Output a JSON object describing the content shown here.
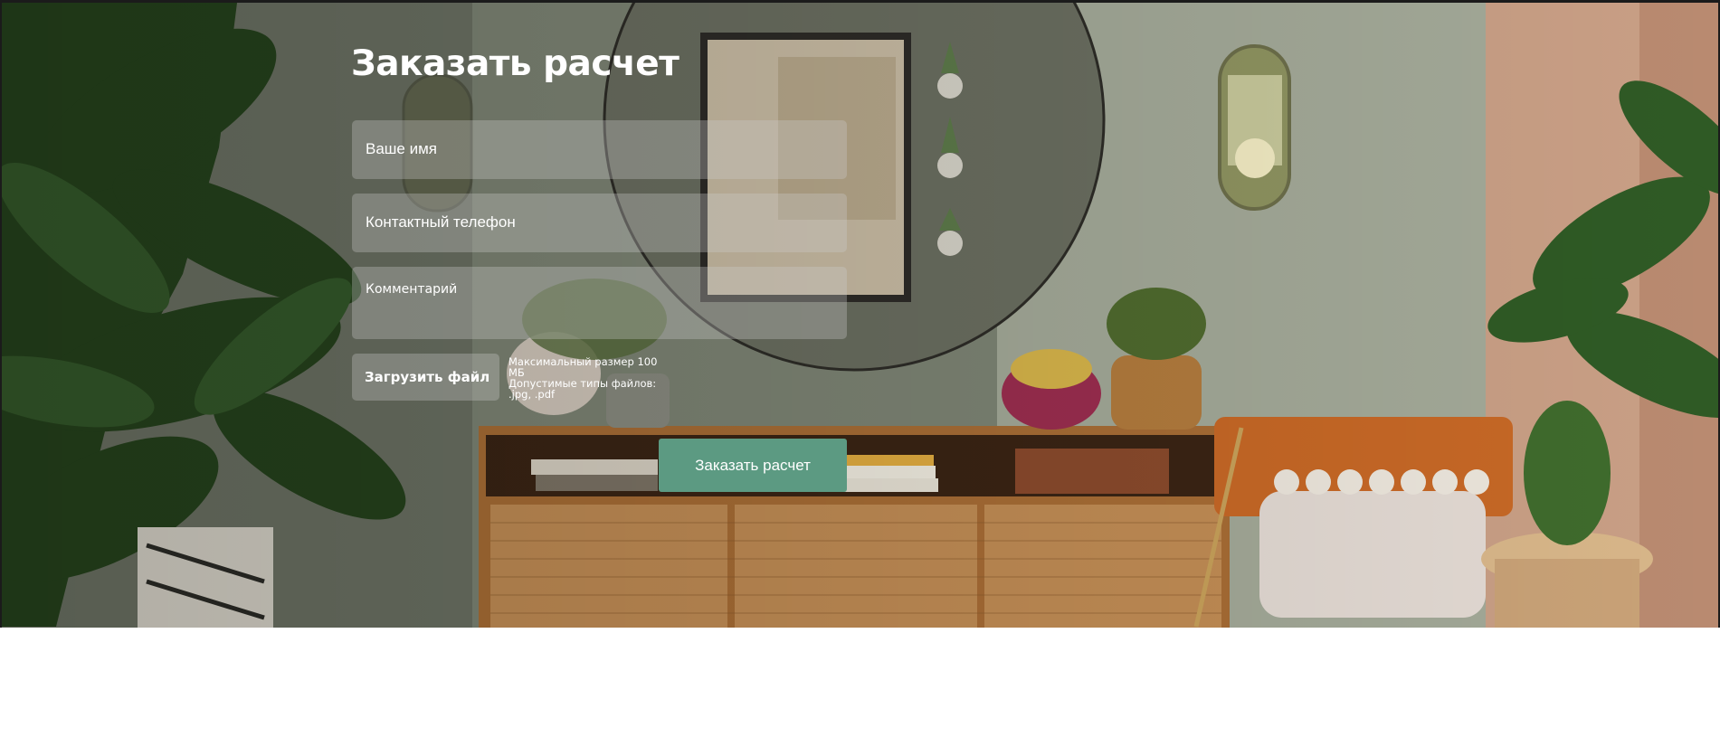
{
  "form": {
    "title": "Заказать расчет",
    "name_placeholder": "Ваше имя",
    "phone_placeholder": "Контактный телефон",
    "comment_placeholder": "Комментарий",
    "upload_label": "Загрузить файл",
    "upload_max_size": "Максимальный размер 100 МБ",
    "upload_types": "Допустимые типы файлов: .jpg, .pdf",
    "submit_label": "Заказать расчет"
  },
  "colors": {
    "submit_bg": "#5c9a82",
    "field_bg": "rgba(205,205,205,0.32)",
    "text": "#ffffff"
  },
  "background": {
    "icons": [
      "plant-left",
      "round-mirror",
      "framed-art",
      "wall-lamp",
      "sideboard",
      "armchair",
      "side-table"
    ]
  }
}
